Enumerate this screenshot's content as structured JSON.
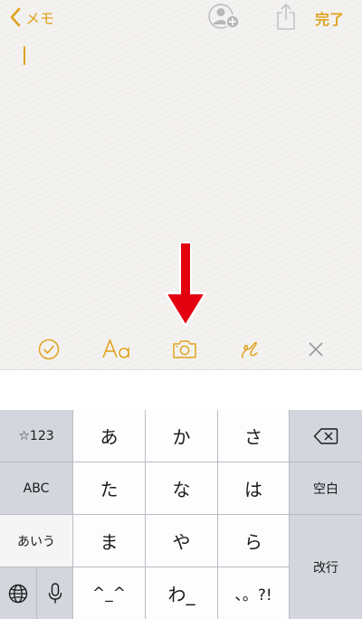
{
  "nav": {
    "back_label": "メモ",
    "done_label": "完了"
  },
  "keyboard": {
    "left": {
      "r1": "☆123",
      "r2": "ABC",
      "r3": "あいう"
    },
    "main": {
      "r1": [
        "あ",
        "か",
        "さ"
      ],
      "r2": [
        "た",
        "な",
        "は"
      ],
      "r3": [
        "ま",
        "や",
        "ら"
      ],
      "r4": [
        "^_^",
        "わ_",
        "、。?!"
      ]
    },
    "right": {
      "space": "空白",
      "enter": "改行"
    }
  },
  "colors": {
    "accent": "#e0a31f",
    "arrow": "#e3000f"
  }
}
